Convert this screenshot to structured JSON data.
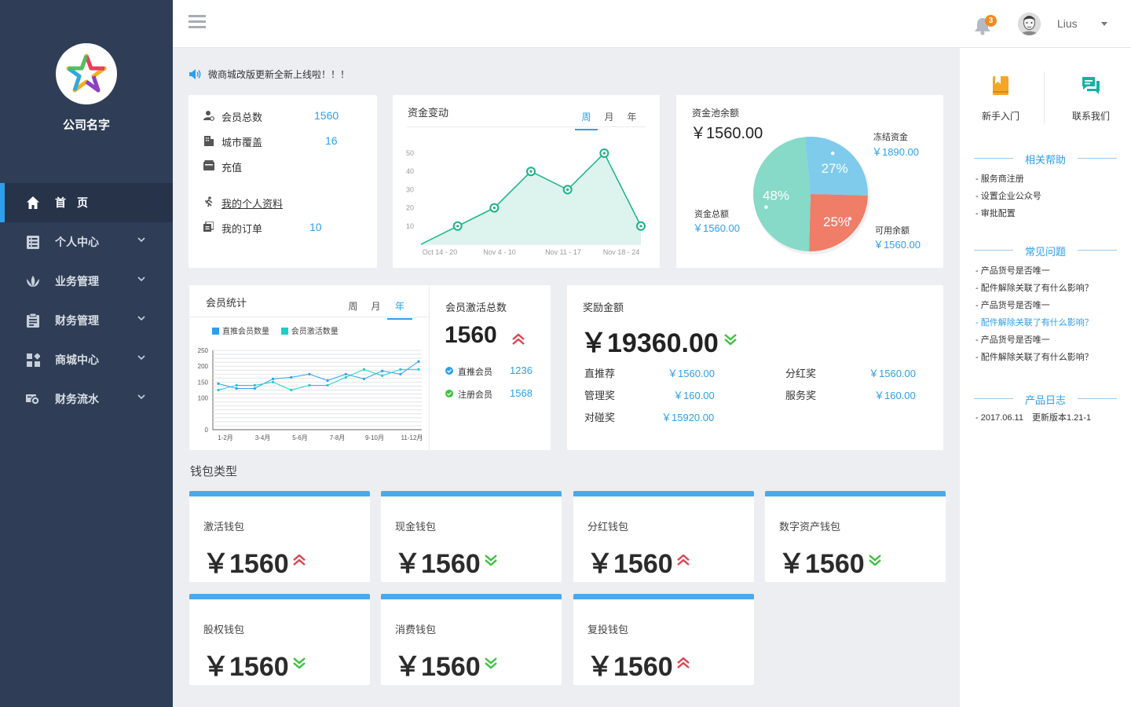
{
  "sidebar": {
    "company_name": "公司名字",
    "items": [
      {
        "label": "首　页",
        "icon": "home-icon",
        "active": true
      },
      {
        "label": "个人中心",
        "icon": "list-icon"
      },
      {
        "label": "业务管理",
        "icon": "lotus-icon"
      },
      {
        "label": "财务管理",
        "icon": "clipboard-icon"
      },
      {
        "label": "商城中心",
        "icon": "grid-icon"
      },
      {
        "label": "财务流水",
        "icon": "money-icon"
      }
    ]
  },
  "topbar": {
    "notification_count": "3",
    "user_name": "Lius"
  },
  "notice": "微商城改版更新全新上线啦！！！",
  "stats_card": {
    "member_total_label": "会员总数",
    "member_total": "1560",
    "city_label": "城市覆盖",
    "city": "16",
    "recharge_label": "充值",
    "profile_label": "我的个人资料",
    "orders_label": "我的订单",
    "orders": "10"
  },
  "fund_change": {
    "title": "资金变动",
    "tabs": [
      "周",
      "月",
      "年"
    ],
    "active_tab": "周"
  },
  "fund_pool": {
    "title": "资金池余额",
    "amount": "￥1560.00",
    "frozen_label": "冻结资金",
    "frozen": "￥1890.00",
    "total_label": "资金总额",
    "total": "￥1560.00",
    "available_label": "可用余额",
    "available": "￥1560.00"
  },
  "member_stats": {
    "title": "会员统计",
    "tabs": [
      "周",
      "月",
      "年"
    ],
    "active_tab": "年"
  },
  "activation": {
    "title": "会员激活总数",
    "total": "1560",
    "direct_label": "直推会员",
    "direct": "1236",
    "registered_label": "注册会员",
    "registered": "1568"
  },
  "reward": {
    "title": "奖励金额",
    "total": "￥19360.00",
    "items": [
      {
        "label": "直推荐",
        "value": "￥1560.00"
      },
      {
        "label": "分红奖",
        "value": "￥1560.00"
      },
      {
        "label": "管理奖",
        "value": "￥160.00"
      },
      {
        "label": "服务奖",
        "value": "￥160.00"
      },
      {
        "label": "对碰奖",
        "value": "￥15920.00"
      }
    ]
  },
  "wallet_section_title": "钱包类型",
  "wallets": [
    {
      "name": "激活钱包",
      "value": "￥1560",
      "trend": "up"
    },
    {
      "name": "现金钱包",
      "value": "￥1560",
      "trend": "down"
    },
    {
      "name": "分红钱包",
      "value": "￥1560",
      "trend": "up"
    },
    {
      "name": "数字资产钱包",
      "value": "￥1560",
      "trend": "down"
    },
    {
      "name": "股权钱包",
      "value": "￥1560",
      "trend": "down"
    },
    {
      "name": "消费钱包",
      "value": "￥1560",
      "trend": "down"
    },
    {
      "name": "复投钱包",
      "value": "￥1560",
      "trend": "up"
    }
  ],
  "right_panel": {
    "guide_label": "新手入门",
    "contact_label": "联系我们",
    "help_title": "相关帮助",
    "help_items": [
      "- 服务商注册",
      "- 设置企业公众号",
      "- 审批配置"
    ],
    "faq_title": "常见问题",
    "faq_items": [
      "- 产品货号是否唯一",
      "- 配件解除关联了有什么影响？",
      "- 产品货号是否唯一",
      "- 配件解除关联了有什么影响？",
      "- 产品货号是否唯一",
      "- 配件解除关联了有什么影响？"
    ],
    "faq_highlight_index": 3,
    "log_title": "产品日志",
    "log_items": [
      "- 2017.06.11　更新版本1.21-1"
    ]
  },
  "colors": {
    "sidebar_bg": "#2f3e56",
    "accent": "#2e9fea",
    "up": "#e0434f",
    "down": "#3bc23f",
    "area_line": "#19b28a",
    "pie_blue": "#7ecbec",
    "pie_red": "#ef7d68",
    "pie_teal": "#86dac7",
    "series_direct": "#2e9fea",
    "series_active": "#1ccfc6"
  },
  "chart_data": [
    {
      "type": "area",
      "title": "资金变动",
      "categories": [
        "Oct 14 - 20",
        "Nov 4 - 10",
        "Nov 11 - 17",
        "Nov 18 - 24"
      ],
      "x": [
        0,
        1,
        2,
        3,
        4,
        5,
        6
      ],
      "values": [
        0,
        10,
        20,
        40,
        30,
        50,
        10
      ],
      "yticks": [
        10,
        20,
        30,
        40,
        50
      ],
      "ylim": [
        0,
        50
      ]
    },
    {
      "type": "pie",
      "slices": [
        {
          "label": "27%",
          "value": 27,
          "color": "#7ecbec"
        },
        {
          "label": "25%",
          "value": 25,
          "color": "#ef7d68"
        },
        {
          "label": "48%",
          "value": 48,
          "color": "#86dac7"
        }
      ]
    },
    {
      "type": "line",
      "title": "会员统计",
      "categories": [
        "1-2月",
        "3-4月",
        "5-6月",
        "7-8月",
        "9-10月",
        "11-12月"
      ],
      "yticks": [
        0,
        100,
        150,
        200,
        250
      ],
      "ylim": [
        0,
        250
      ],
      "series": [
        {
          "name": "直推会员数量",
          "color": "#2e9fea",
          "values": [
            145,
            130,
            130,
            160,
            165,
            175,
            155,
            175,
            160,
            185,
            175,
            215
          ]
        },
        {
          "name": "会员激活数量",
          "color": "#1ccfc6",
          "values": [
            125,
            140,
            140,
            150,
            125,
            140,
            140,
            165,
            190,
            170,
            190,
            190
          ]
        }
      ]
    }
  ]
}
